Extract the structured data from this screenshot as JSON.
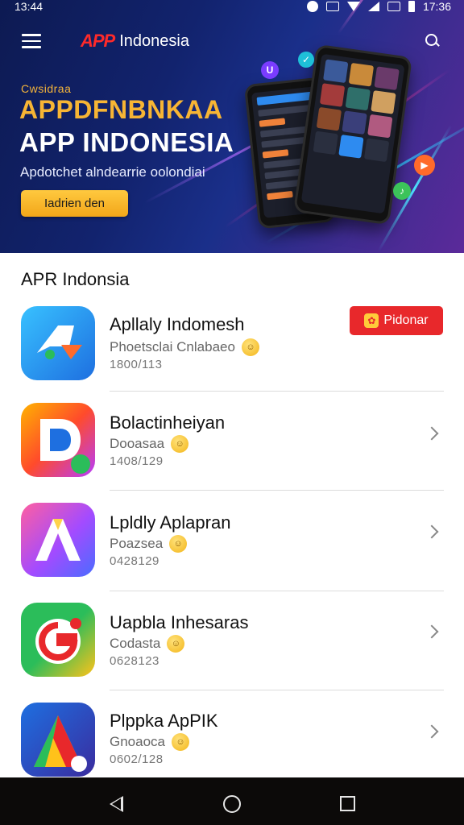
{
  "status_bar": {
    "time": "13:44",
    "right_time": "17:36"
  },
  "header": {
    "logo_text": "APP",
    "title": "Indonesia"
  },
  "hero": {
    "eyebrow": "Cwsidraa",
    "title_line1": "APPDFNBNKAA",
    "title_line2": "APP INDONESIA",
    "subtitle": "Apdotchet alndearrie oolondiai",
    "button_label": "Iadrien den"
  },
  "section": {
    "title": "APR Indonsia"
  },
  "apps": [
    {
      "name": "Apllaly Indomesh",
      "subtitle": "Phoetsclai Cnlabaeo",
      "meta": "1800/113",
      "icon": "arrow-icon"
    },
    {
      "name": "Bolactinheiyan",
      "subtitle": "Dooasaa",
      "meta": "1408/129",
      "icon": "d-logo-icon"
    },
    {
      "name": "Lpldly Aplapran",
      "subtitle": "Poazsea",
      "meta": "0428129",
      "icon": "a-logo-icon"
    },
    {
      "name": "Uapbla Inhesaras",
      "subtitle": "Codasta",
      "meta": "0628123",
      "icon": "g-logo-icon"
    },
    {
      "name": "Plppka ApPIK",
      "subtitle": "Gnoaoca",
      "meta": "0602/128",
      "icon": "triangle-logo-icon"
    }
  ],
  "badge": {
    "label": "Pidonar"
  },
  "colors": {
    "accent": "#f7b534",
    "badge": "#e8282b",
    "hero_bg": "#12236e"
  }
}
